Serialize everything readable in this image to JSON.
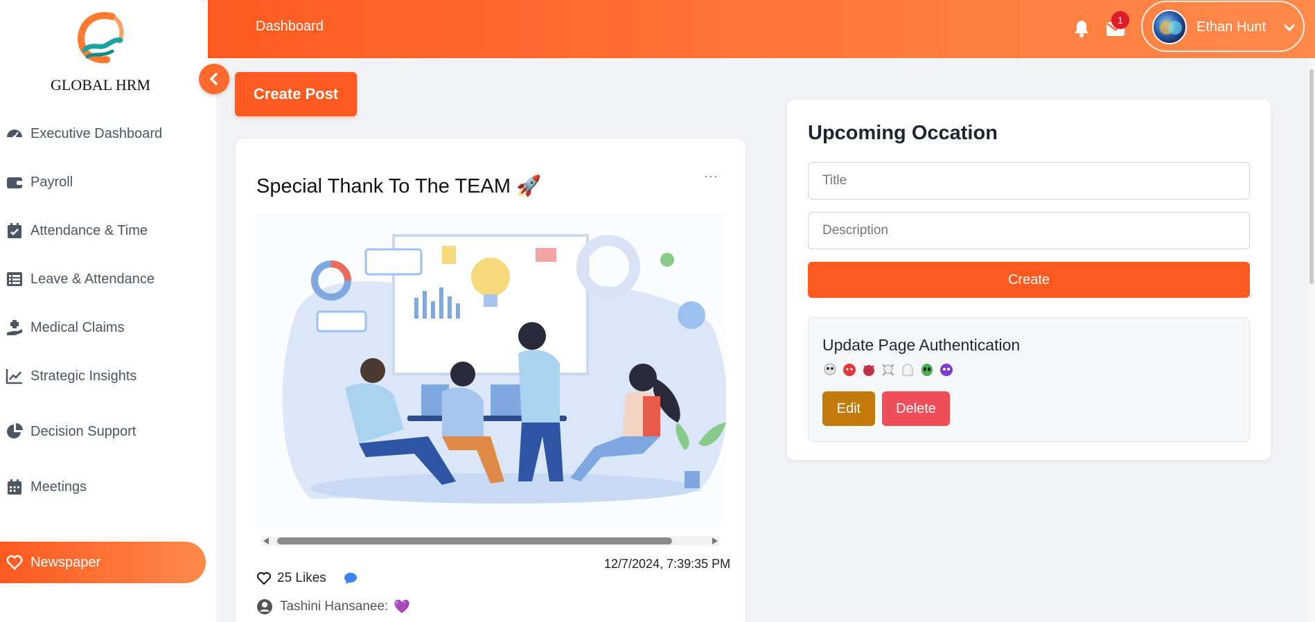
{
  "sidebar": {
    "brand": "GLOBAL HRM",
    "items": [
      {
        "label": "Executive Dashboard",
        "icon": "gauge-icon"
      },
      {
        "label": "Payroll",
        "icon": "wallet-icon"
      },
      {
        "label": "Attendance & Time",
        "icon": "calendar-check-icon"
      },
      {
        "label": "Leave & Attendance",
        "icon": "list-icon"
      },
      {
        "label": "Medical Claims",
        "icon": "hand-medical-icon"
      },
      {
        "label": "Strategic Insights",
        "icon": "chart-line-icon"
      },
      {
        "label": "Decision Support",
        "icon": "pie-chart-icon"
      },
      {
        "label": "Meetings",
        "icon": "calendar-icon"
      },
      {
        "label": "Newspaper",
        "icon": "heart-icon",
        "active": true
      }
    ]
  },
  "header": {
    "breadcrumb": "Dashboard",
    "mail_badge": "1",
    "user_name": "Ethan Hunt"
  },
  "main": {
    "create_post_label": "Create Post",
    "post": {
      "title": "Special Thank To The TEAM 🚀",
      "more": "···",
      "timestamp": "12/7/2024, 7:39:35 PM",
      "likes": "25 Likes",
      "comment_author": "Tashini Hansanee:",
      "comment_text": "💜"
    }
  },
  "occasion": {
    "heading": "Upcoming Occation",
    "title_placeholder": "Title",
    "description_placeholder": "Description",
    "create_label": "Create",
    "item": {
      "title": "Update Page Authentication",
      "edit_label": "Edit",
      "delete_label": "Delete"
    }
  },
  "colors": {
    "accent": "#ff5a1f",
    "edit": "#c47a0b",
    "delete": "#ef4d58",
    "badge": "#e21b2a"
  }
}
